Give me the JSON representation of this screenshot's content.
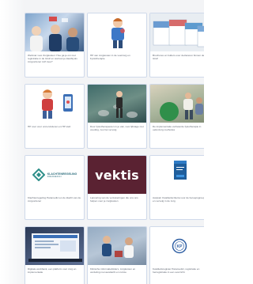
{
  "cards": [
    {
      "id": "card-1",
      "caption": "Webinar voor Zorgkosten: Hoe ga je om met registratie in de GGZ en wat kan je daarbij als zorgverlener zelf mee?"
    },
    {
      "id": "card-2",
      "caption": "HP van zorgkosten in de voetzorg en Fysiotherapie"
    },
    {
      "id": "card-3",
      "caption": "Brochures en folders over declareren binnen de GGZ"
    },
    {
      "id": "card-4",
      "caption": "HP voor voor onze kinderen en HP stelt"
    },
    {
      "id": "card-5",
      "caption": "Door fysiotherapeuten in je vak, voor lijfstage met voeding, zes het vervolg"
    },
    {
      "id": "card-6",
      "caption": "De implementatie verbeterde fysiotherapie in oefenzorg methodes"
    },
    {
      "id": "card-7",
      "caption": "Klachtenregeling Paramedici en de klacht van de zorgverlener"
    },
    {
      "id": "card-8",
      "caption": "Lancering van de verzekeringen die ons ons helpen voor je zorgkosten"
    },
    {
      "id": "card-9",
      "caption": "Aanpak: Kwaliteitscriteria voor de beroepsgroep en vervolg in de zorg"
    },
    {
      "id": "card-10",
      "caption": "Digitale werkbank, een platform voor zorg en implementatie"
    },
    {
      "id": "card-11",
      "caption": "Klinische informatiefolders, zorgkosten en verdeling met aandacht en ruimte"
    },
    {
      "id": "card-12",
      "caption": "Kwaliteitsregister Paramedici, registratie en herregistratie in een overzicht"
    }
  ],
  "logos": {
    "klachtenregeling_line1": "KLACHTENREGELING",
    "klachtenregeling_line2": "PARAMEDICI",
    "vektis": "vektis"
  }
}
